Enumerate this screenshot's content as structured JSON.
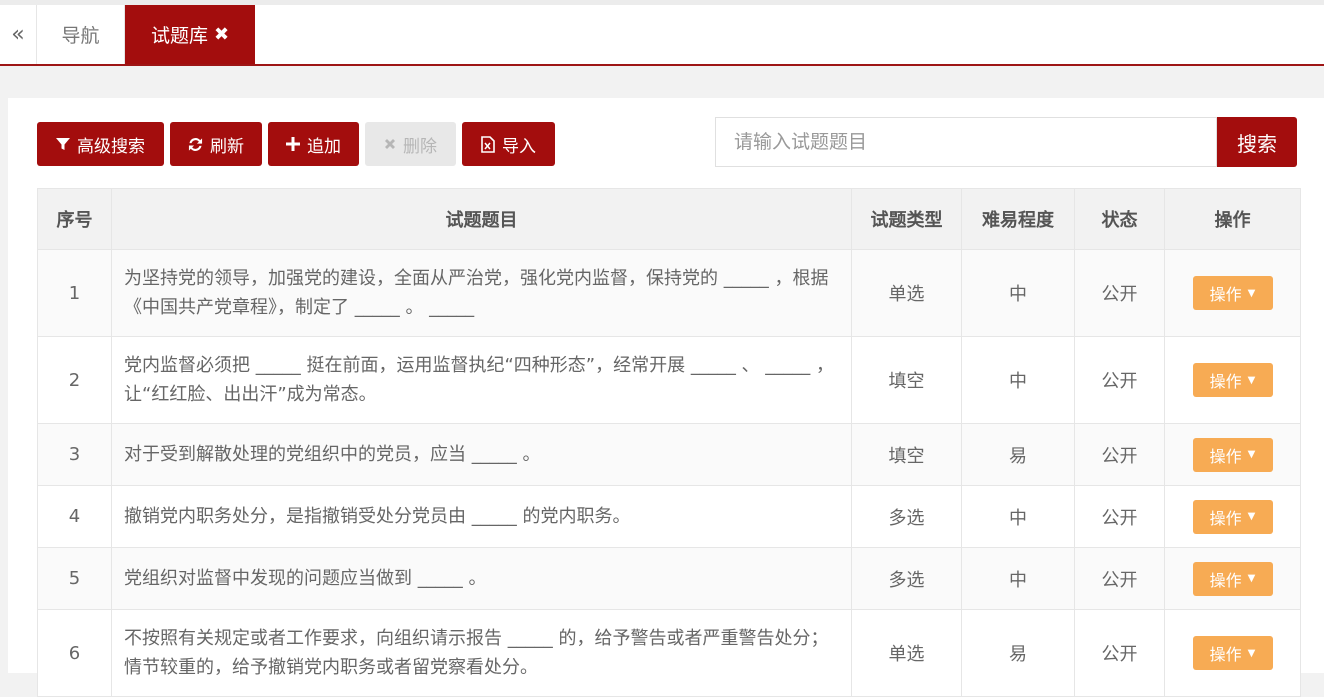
{
  "tabs": {
    "back_icon": "«",
    "items": [
      {
        "label": "导航",
        "active": false
      },
      {
        "label": "试题库",
        "active": true,
        "close_icon": "✖"
      }
    ]
  },
  "toolbar": {
    "advanced_search": "高级搜索",
    "refresh": "刷新",
    "add": "追加",
    "delete": "删除",
    "import": "导入"
  },
  "search": {
    "placeholder": "请输入试题题目",
    "value": "",
    "button": "搜索"
  },
  "table": {
    "headers": [
      "序号",
      "试题题目",
      "试题类型",
      "难易程度",
      "状态",
      "操作"
    ],
    "rows": [
      {
        "no": "1",
        "question": "为坚持党的领导，加强党的建设，全面从严治党，强化党内监督，保持党的 _____ ，根据《中国共产党章程》，制定了 _____ 。 _____",
        "type": "单选",
        "difficulty": "中",
        "status": "公开",
        "action": "操作"
      },
      {
        "no": "2",
        "question": "党内监督必须把 _____ 挺在前面，运用监督执纪“四种形态”，经常开展 _____ 、 _____ ，让“红红脸、出出汗”成为常态。",
        "type": "填空",
        "difficulty": "中",
        "status": "公开",
        "action": "操作"
      },
      {
        "no": "3",
        "question": "对于受到解散处理的党组织中的党员，应当 _____ 。",
        "type": "填空",
        "difficulty": "易",
        "status": "公开",
        "action": "操作"
      },
      {
        "no": "4",
        "question": "撤销党内职务处分，是指撤销受处分党员由 _____ 的党内职务。",
        "type": "多选",
        "difficulty": "中",
        "status": "公开",
        "action": "操作"
      },
      {
        "no": "5",
        "question": "党组织对监督中发现的问题应当做到 _____ 。",
        "type": "多选",
        "difficulty": "中",
        "status": "公开",
        "action": "操作"
      },
      {
        "no": "6",
        "question": "不按照有关规定或者工作要求，向组织请示报告 _____ 的，给予警告或者严重警告处分；情节较重的，给予撤销党内职务或者留党察看处分。",
        "type": "单选",
        "difficulty": "易",
        "status": "公开",
        "action": "操作"
      }
    ]
  },
  "colors": {
    "primary": "#a30d0d",
    "action": "#f7ab54"
  }
}
